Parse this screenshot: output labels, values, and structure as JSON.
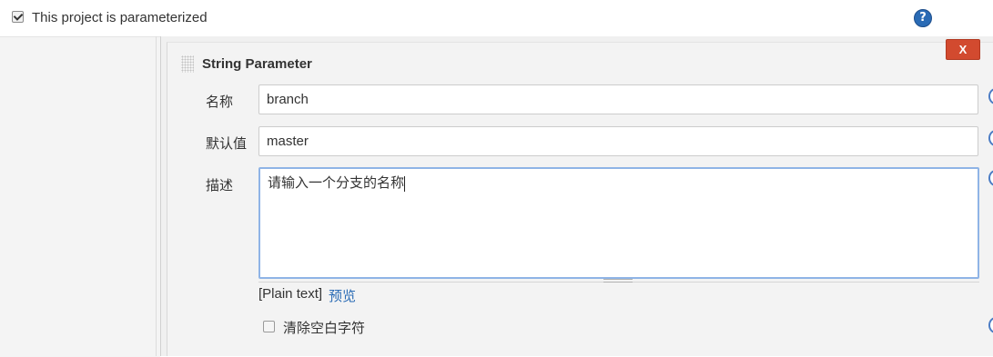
{
  "header": {
    "parameterized_label": "This project is parameterized",
    "parameterized_checked": true,
    "help_icon_text": "?"
  },
  "param": {
    "title": "String Parameter",
    "delete_label": "X",
    "name_label": "名称",
    "name_value": "branch",
    "default_label": "默认值",
    "default_value": "master",
    "description_label": "描述",
    "description_value": "请输入一个分支的名称",
    "format_label": "[Plain text]",
    "preview_link": "预览",
    "trim_label": "清除空白字符",
    "trim_checked": false
  },
  "colors": {
    "delete_button": "#d24a2f",
    "link": "#2a6bb5",
    "focus_border": "#8fb4e6",
    "help_icon": "#2a6bb5"
  }
}
